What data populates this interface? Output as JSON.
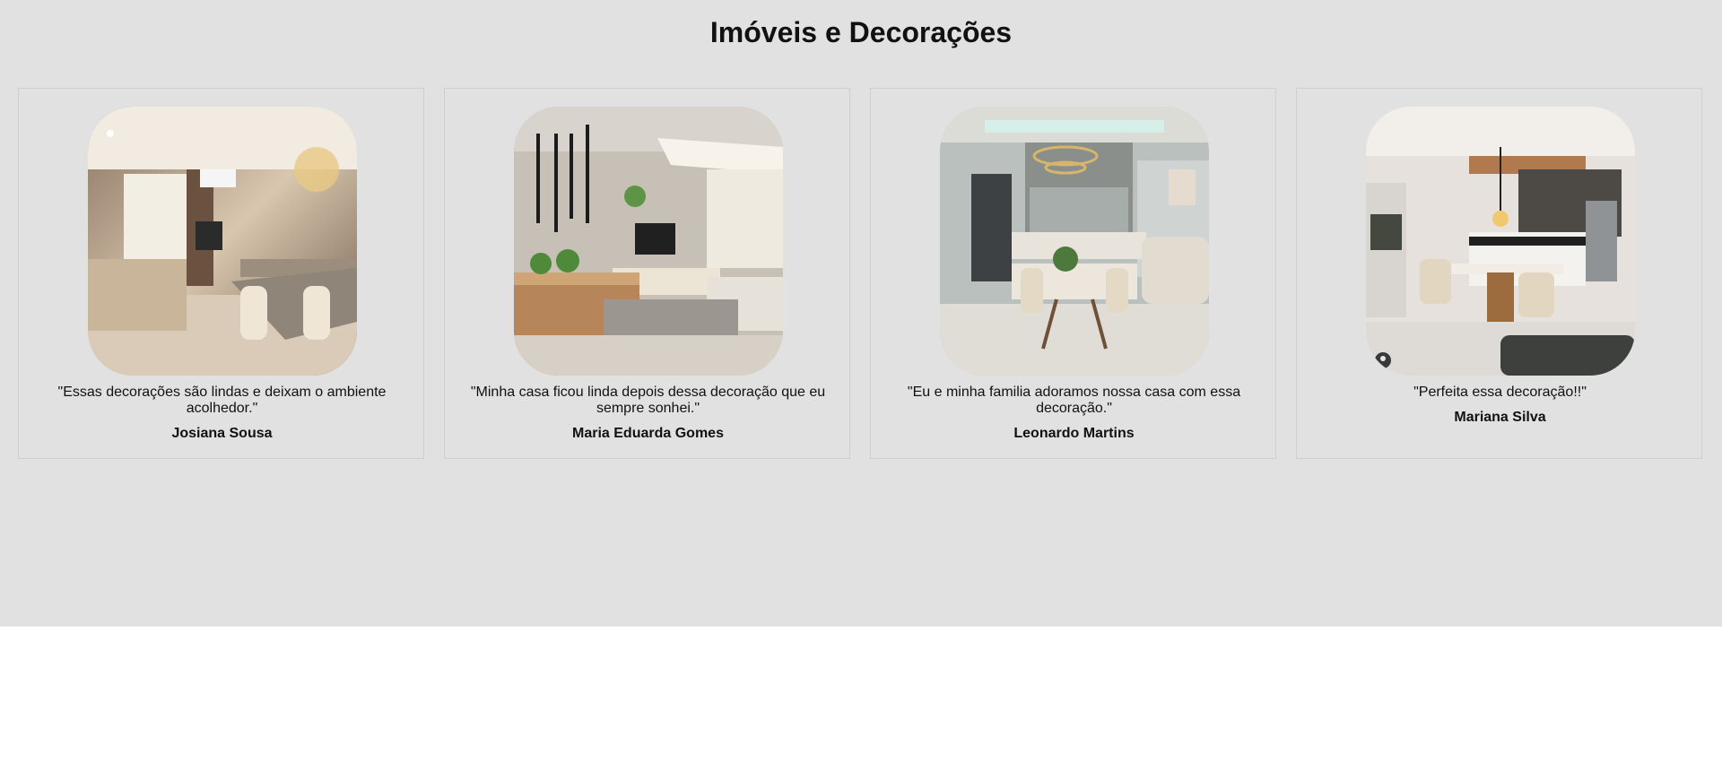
{
  "page": {
    "title": "Imóveis e Decorações",
    "background": "#e1e1e1"
  },
  "testimonials": [
    {
      "quote": "\"Essas decorações são lindas e deixam o ambiente acolhedor.\"",
      "author": "Josiana Sousa",
      "image": "living-dining-room-photo"
    },
    {
      "quote": "\"Minha casa ficou linda depois dessa decoração que eu sempre sonhei.\"",
      "author": "Maria Eduarda Gomes",
      "image": "open-living-kitchen-photo"
    },
    {
      "quote": "\"Eu e minha familia adoramos nossa casa com essa decoração.\"",
      "author": "Leonardo Martins",
      "image": "kitchen-dining-room-photo"
    },
    {
      "quote": "\"Perfeita essa decoração!!\"",
      "author": "Mariana Silva",
      "image": "modern-kitchen-photo"
    }
  ]
}
